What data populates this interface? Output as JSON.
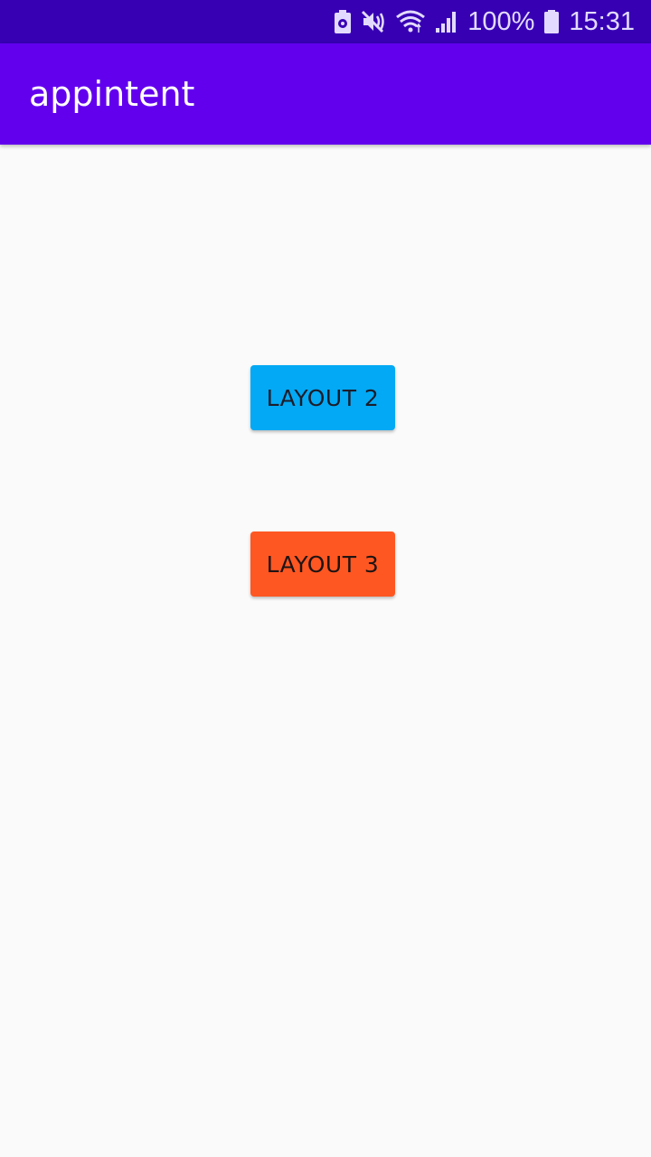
{
  "status_bar": {
    "battery_percent": "100%",
    "time": "15:31",
    "icons": [
      "battery-saver-icon",
      "mute-icon",
      "wifi-icon",
      "signal-icon",
      "battery-icon"
    ]
  },
  "app_bar": {
    "title": "appintent"
  },
  "buttons": {
    "layout2_label": "LAYOUT 2",
    "layout3_label": "LAYOUT 3"
  },
  "colors": {
    "status_bar": "#3700b3",
    "app_bar": "#6200ee",
    "background": "#fafafa",
    "layout2_button": "#03a9f4",
    "layout3_button": "#ff5722"
  }
}
